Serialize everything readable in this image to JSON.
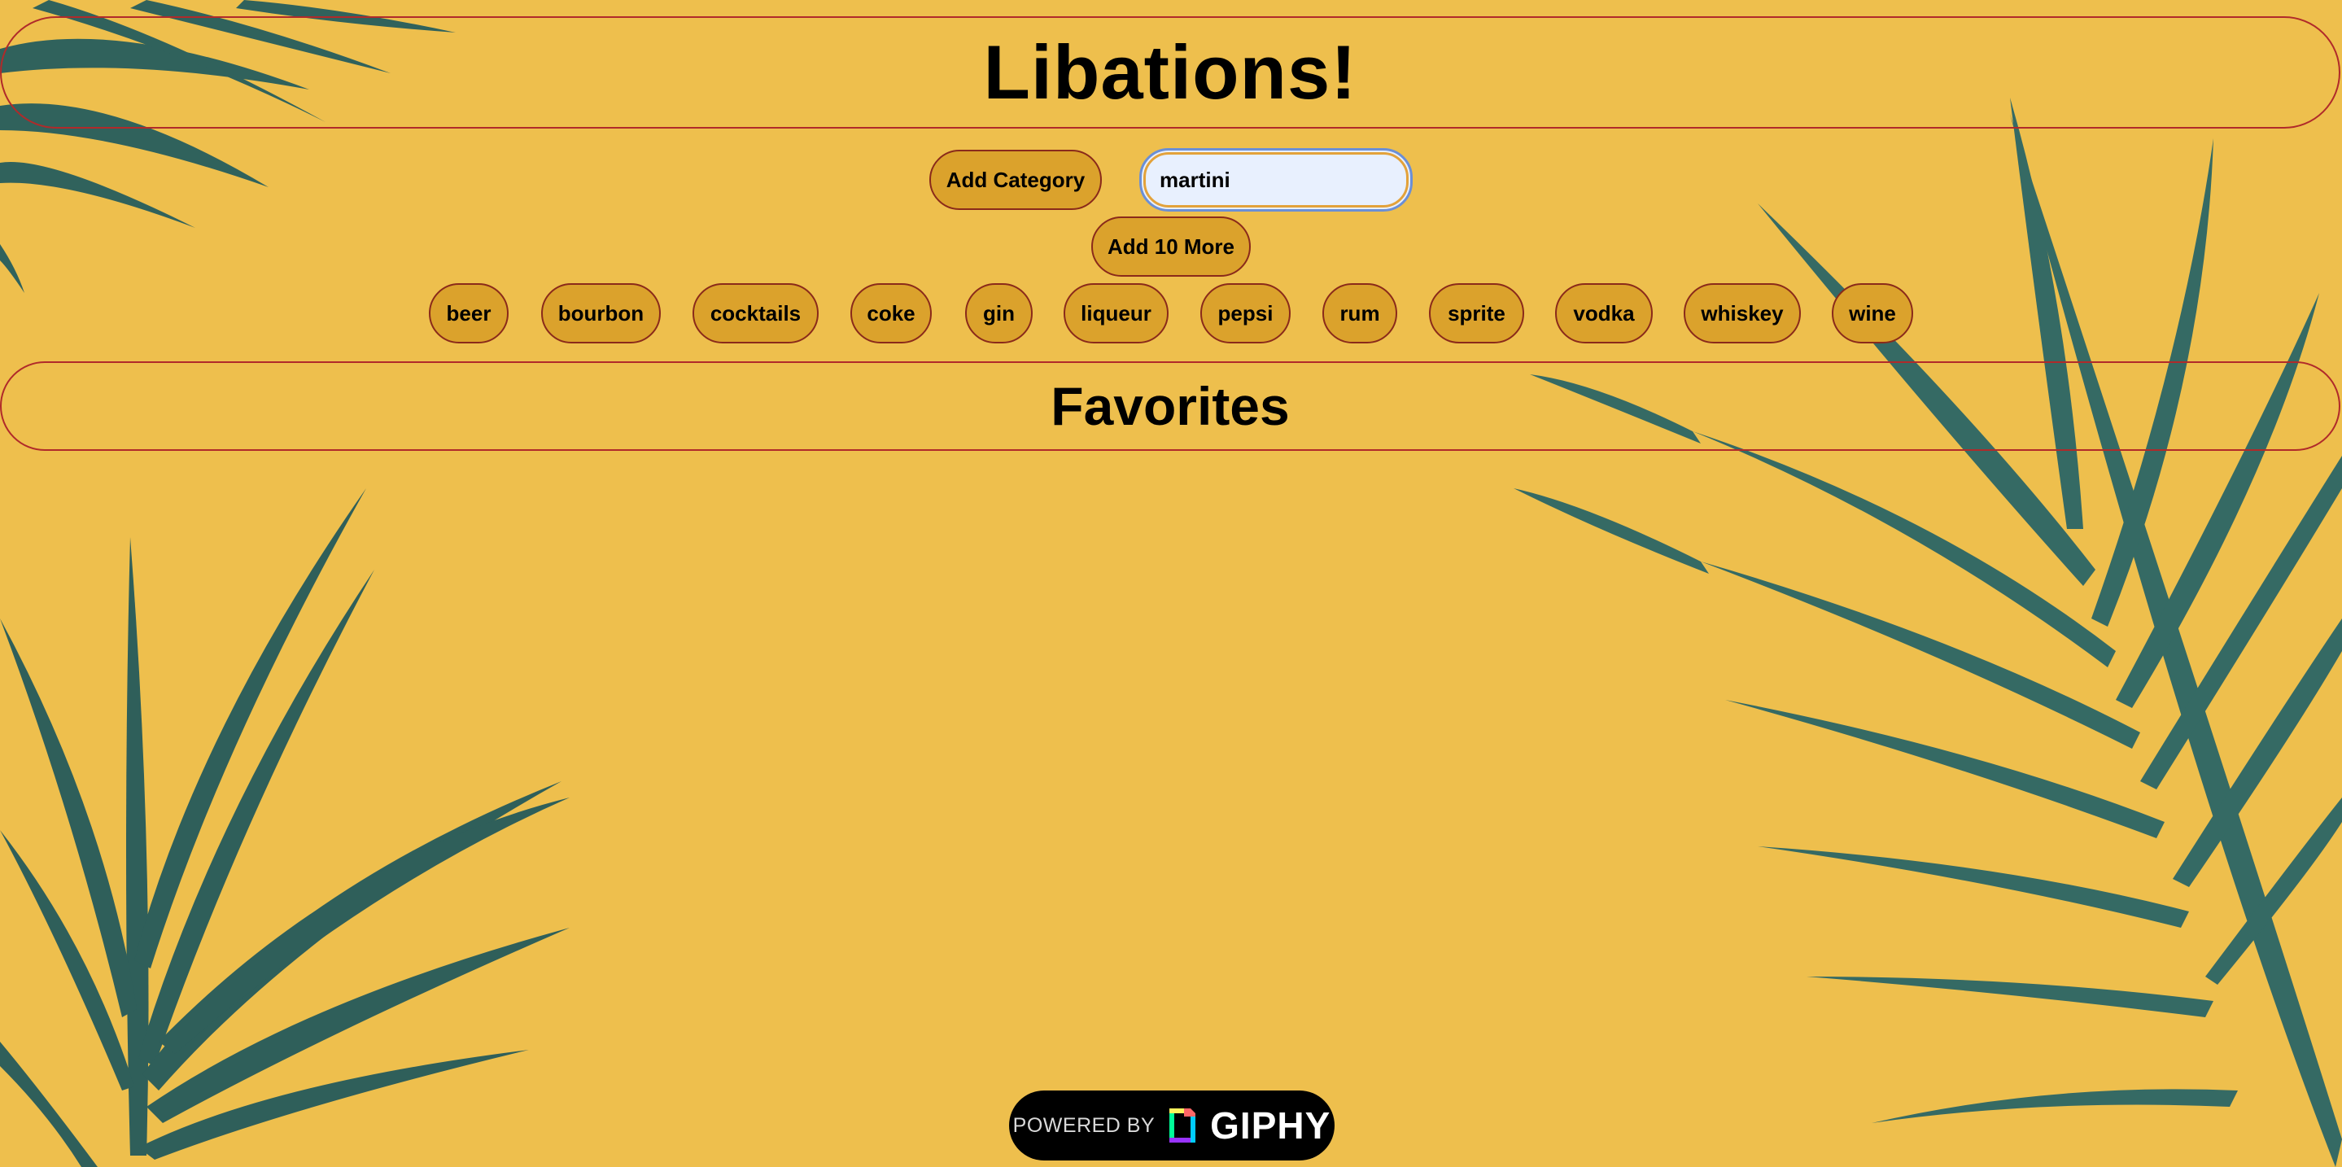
{
  "header": {
    "title": "Libations!"
  },
  "controls": {
    "add_category_label": "Add Category",
    "search_value": "martini",
    "add_more_label": "Add 10 More"
  },
  "categories": [
    "beer",
    "bourbon",
    "cocktails",
    "coke",
    "gin",
    "liqueur",
    "pepsi",
    "rum",
    "sprite",
    "vodka",
    "whiskey",
    "wine"
  ],
  "favorites": {
    "title": "Favorites"
  },
  "footer": {
    "powered_by": "POWERED BY",
    "brand": "GIPHY"
  },
  "colors": {
    "background": "#eebf4d",
    "button": "#dba22c",
    "button_border": "#8a2a1a",
    "section_border": "#b02a2a",
    "leaf": "#2f5f5a"
  }
}
